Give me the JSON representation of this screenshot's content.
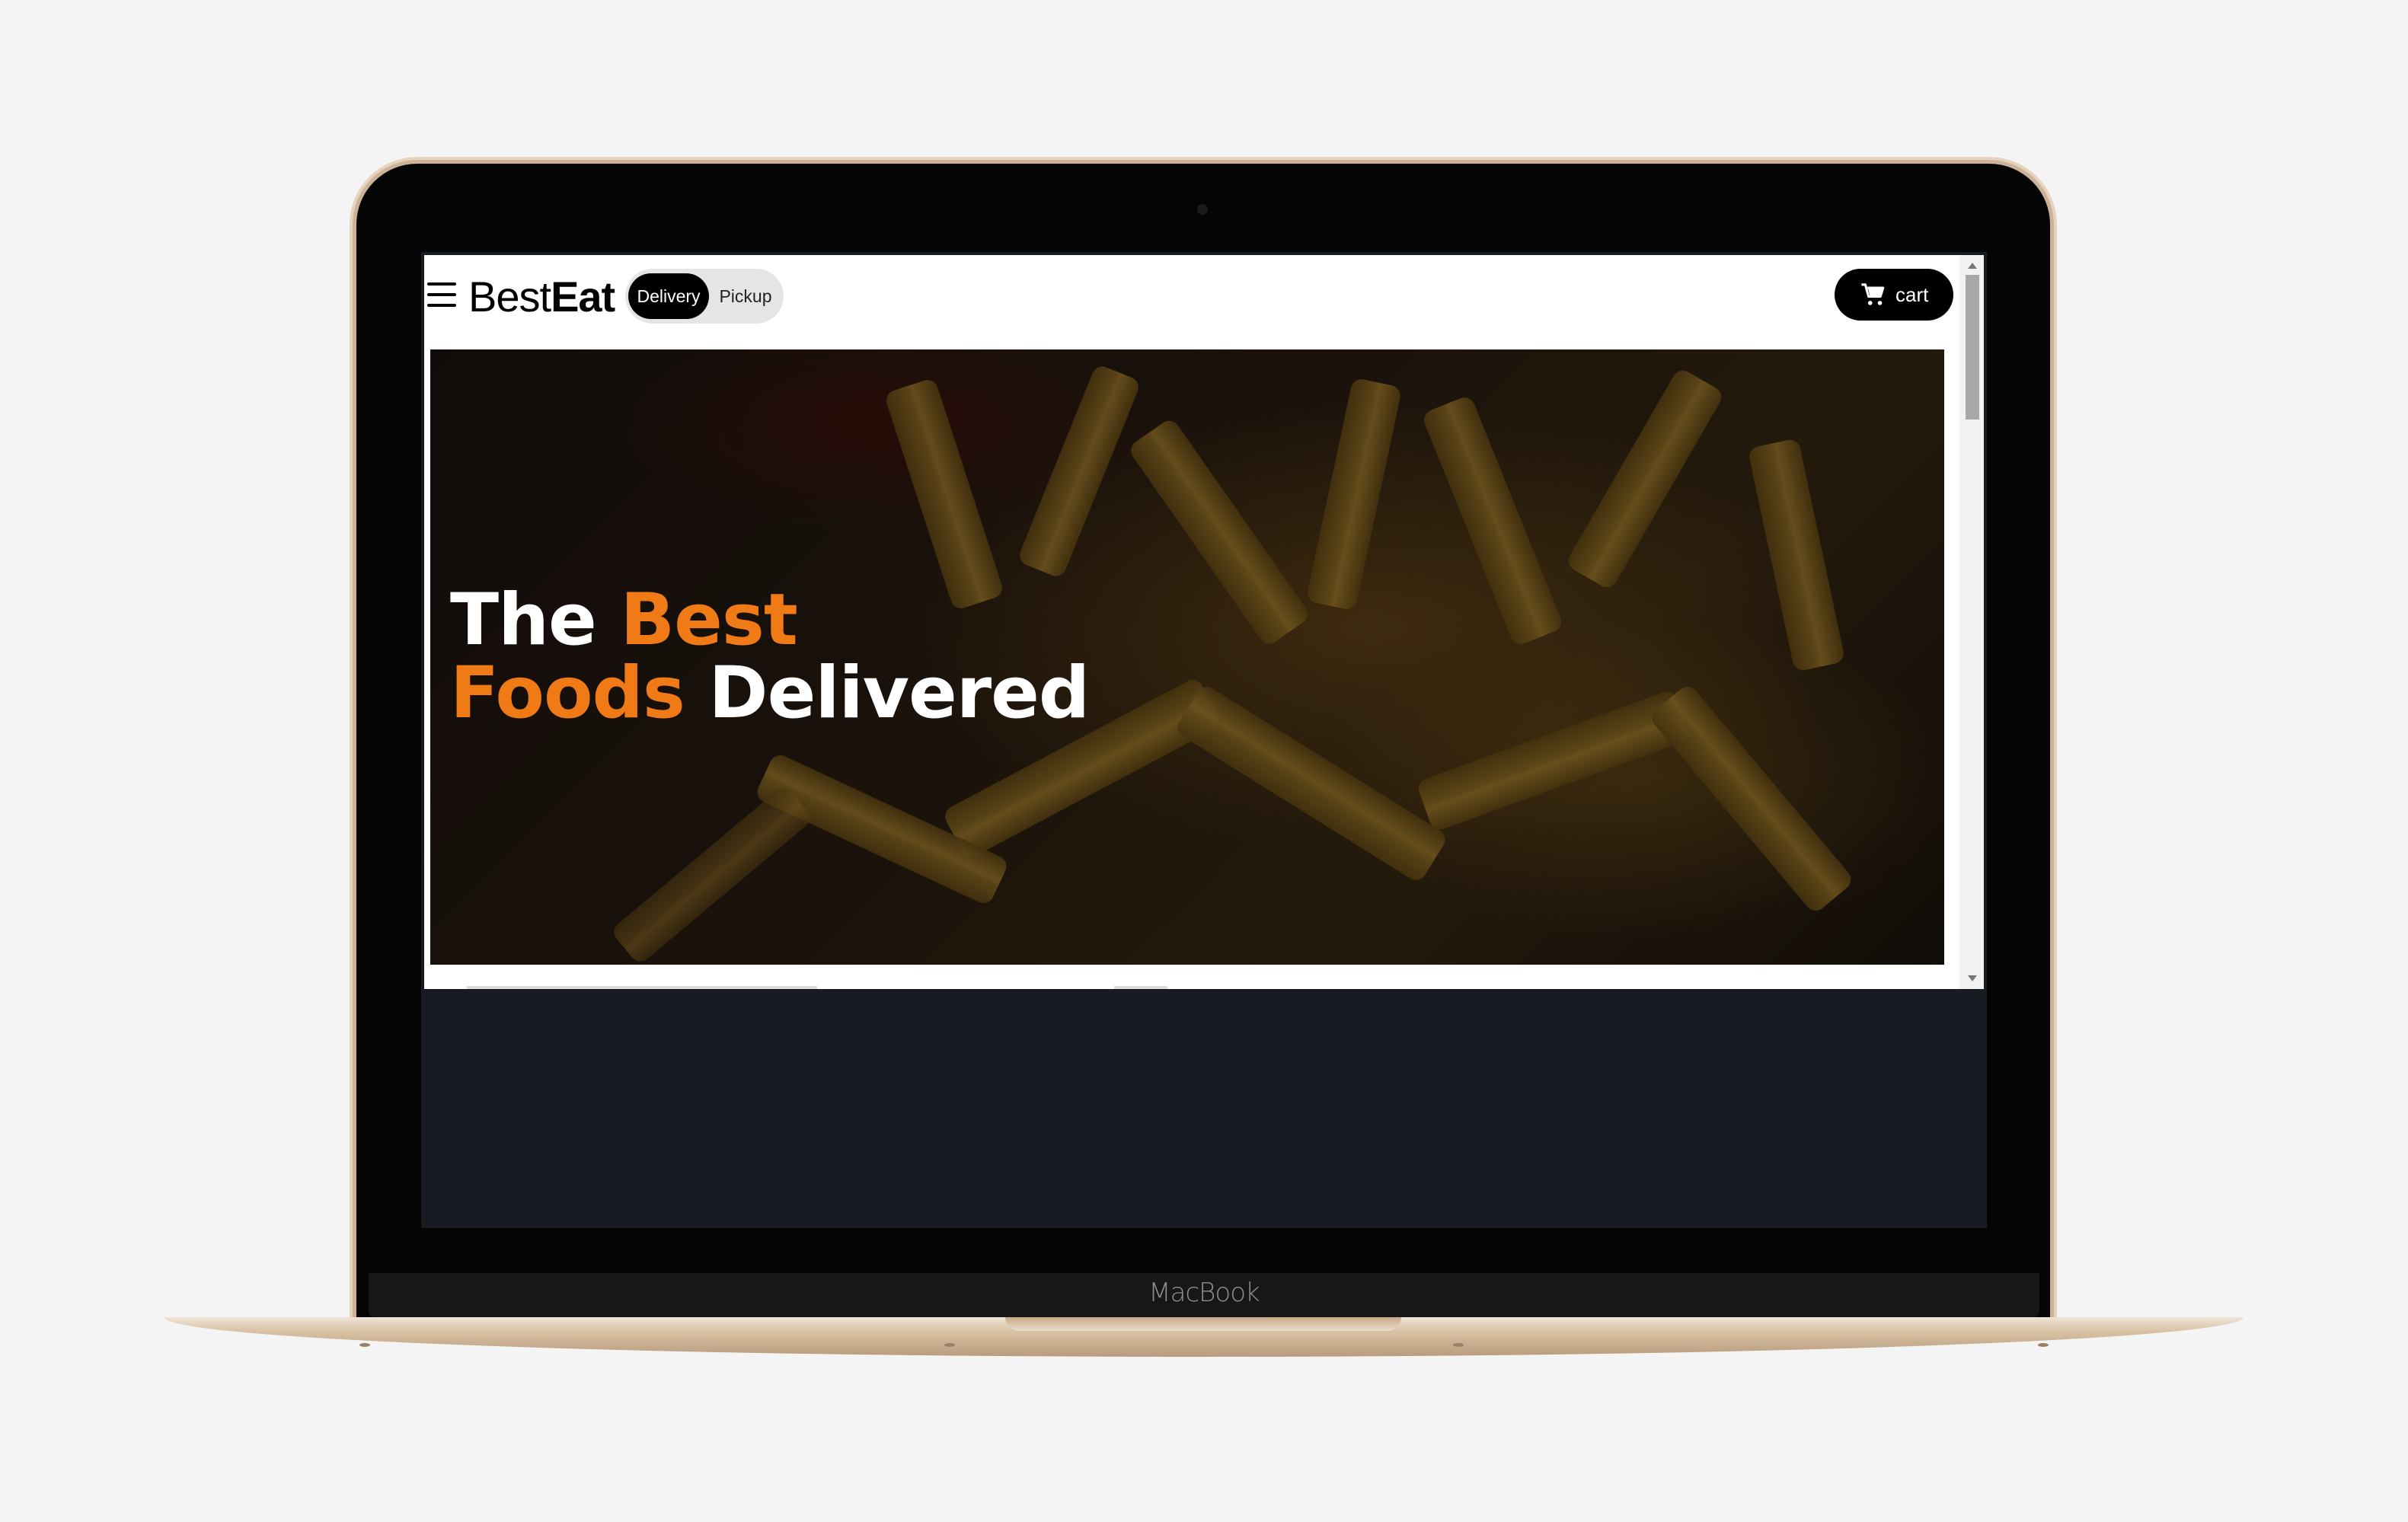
{
  "device": {
    "label": "MacBook"
  },
  "header": {
    "logo_regular": "Best",
    "logo_bold": "Eat",
    "toggle": {
      "delivery_label": "Delivery",
      "pickup_label": "Pickup",
      "selected": "Delivery"
    },
    "cart_label": "cart"
  },
  "hero": {
    "line1_plain": "The",
    "line1_accent": "Best",
    "line2_accent": "Foods",
    "line2_plain": "Delivered",
    "accent_color": "#f07a16"
  },
  "icons": [
    "hamburger-icon",
    "cart-icon"
  ]
}
